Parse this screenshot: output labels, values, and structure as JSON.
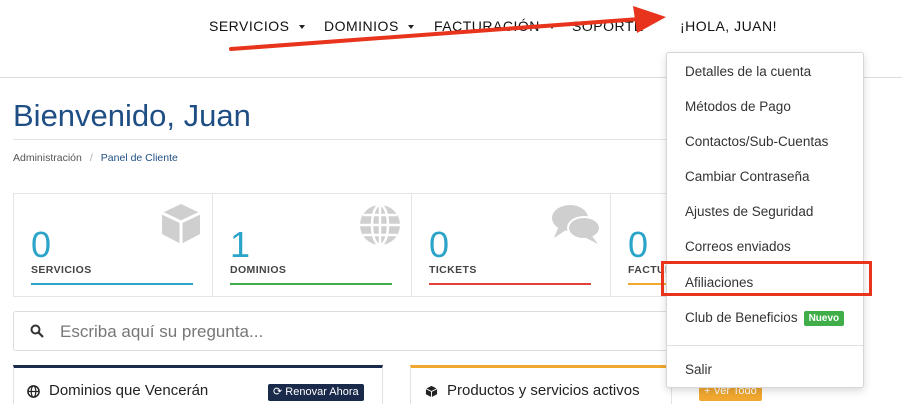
{
  "nav": {
    "items": [
      {
        "label": "SERVICIOS"
      },
      {
        "label": "DOMINIOS"
      },
      {
        "label": "FACTURACIÓN"
      },
      {
        "label": "SOPORTE"
      }
    ],
    "greeting": "¡HOLA, JUAN!"
  },
  "page": {
    "title": "Bienvenido, Juan",
    "breadcrumb": [
      "Administración",
      "Panel de Cliente"
    ]
  },
  "stats": [
    {
      "value": "0",
      "label": "SERVICIOS",
      "color": "#2aa4c8",
      "icon": "box-icon"
    },
    {
      "value": "1",
      "label": "DOMINIOS",
      "color": "#3fae49",
      "icon": "globe-icon"
    },
    {
      "value": "0",
      "label": "TICKETS",
      "color": "#e2403b",
      "icon": "comments-icon"
    },
    {
      "value": "0",
      "label": "FACTURAS",
      "color": "#f0a830",
      "icon": "credit-card-icon"
    }
  ],
  "search": {
    "placeholder": "Escriba aquí su pregunta..."
  },
  "panels": {
    "domains": {
      "title": "Dominios que Vencerán",
      "button": "Renovar Ahora",
      "accent": "#1a2a4a"
    },
    "products": {
      "title": "Productos y servicios activos",
      "button": "+ Ver Todo",
      "accent": "#f0a830"
    }
  },
  "dropdown": {
    "items": [
      {
        "label": "Detalles de la cuenta"
      },
      {
        "label": "Métodos de Pago"
      },
      {
        "label": "Contactos/Sub-Cuentas"
      },
      {
        "label": "Cambiar Contraseña"
      },
      {
        "label": "Ajustes de Seguridad"
      },
      {
        "label": "Correos enviados"
      },
      {
        "label": "Afiliaciones"
      },
      {
        "label": "Club de Beneficios",
        "badge": "Nuevo"
      }
    ],
    "logout": "Salir"
  },
  "colors": {
    "primary": "#1f4e84",
    "annotation": "#e8341c"
  }
}
